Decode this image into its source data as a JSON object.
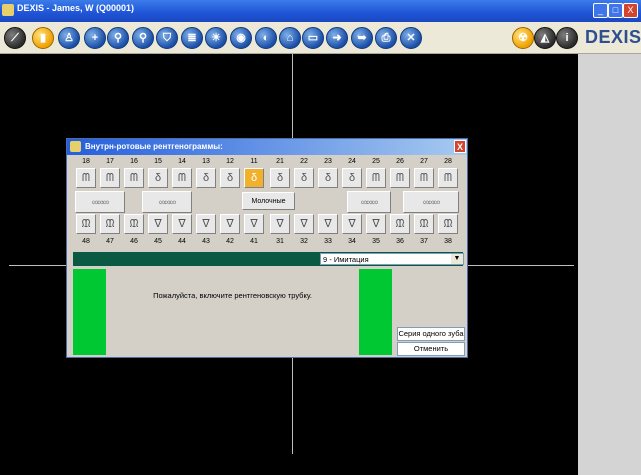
{
  "window": {
    "title": "DEXIS - James, W (Q00001)",
    "min": "_",
    "max": "□",
    "close": "X"
  },
  "toolbar": {
    "buttons": [
      {
        "name": "edit-icon",
        "glyph": "⟋"
      },
      {
        "name": "tooth-icon",
        "glyph": "▮"
      },
      {
        "name": "patient-icon",
        "glyph": "♙"
      },
      {
        "name": "add-icon",
        "glyph": "+"
      },
      {
        "name": "zoom-icon",
        "glyph": "⚲"
      },
      {
        "name": "zoom-out-icon",
        "glyph": "⚲"
      },
      {
        "name": "filter-icon",
        "glyph": "⛉"
      },
      {
        "name": "notes-icon",
        "glyph": "≣"
      },
      {
        "name": "brightness-icon",
        "glyph": "☀"
      },
      {
        "name": "eye-icon",
        "glyph": "◉"
      },
      {
        "name": "sensor-icon",
        "glyph": "◐"
      },
      {
        "name": "home-icon",
        "glyph": "⌂"
      },
      {
        "name": "folder-icon",
        "glyph": "▭"
      },
      {
        "name": "export-icon",
        "glyph": "➜"
      },
      {
        "name": "import-icon",
        "glyph": "➥"
      },
      {
        "name": "print-icon",
        "glyph": "⎙"
      },
      {
        "name": "exit-icon",
        "glyph": "✕"
      }
    ],
    "right_buttons": [
      {
        "name": "radiation-icon",
        "glyph": "☢"
      },
      {
        "name": "eraser-icon",
        "glyph": "◭"
      },
      {
        "name": "info-icon",
        "glyph": "i"
      }
    ],
    "brand": "DEXIS"
  },
  "dialog": {
    "title": "Внутрн-ротовые рентгенограммы:",
    "close": "X",
    "upper_numbers": [
      "18",
      "17",
      "16",
      "15",
      "14",
      "13",
      "12",
      "11",
      "21",
      "22",
      "23",
      "24",
      "25",
      "26",
      "27",
      "28"
    ],
    "lower_numbers": [
      "48",
      "47",
      "46",
      "45",
      "44",
      "43",
      "42",
      "41",
      "31",
      "32",
      "33",
      "34",
      "35",
      "36",
      "37",
      "38"
    ],
    "tooth_glyph_upper": [
      "ᗰ",
      "ᗰ",
      "ᗰ",
      "δ",
      "ᗰ",
      "δ",
      "δ",
      "δ",
      "δ",
      "δ",
      "δ",
      "δ",
      "ᗰ",
      "ᗰ",
      "ᗰ",
      "ᗰ"
    ],
    "tooth_glyph_lower": [
      "ᙢ",
      "ᙢ",
      "ᙢ",
      "ᐁ",
      "ᐁ",
      "ᐁ",
      "ᐁ",
      "ᐁ",
      "ᐁ",
      "ᐁ",
      "ᐁ",
      "ᐁ",
      "ᐁ",
      "ᙢ",
      "ᙢ",
      "ᙢ"
    ],
    "selected_tooth": "11",
    "molar_group_glyph": "∞∞∞",
    "primary_label": "Молочные",
    "mode_selected": "9 - Имитация",
    "message": "Пожалуйста, включите рентгеновскую трубку.",
    "single_tooth_series": "Серия одного зуба",
    "cancel": "Отменить"
  }
}
